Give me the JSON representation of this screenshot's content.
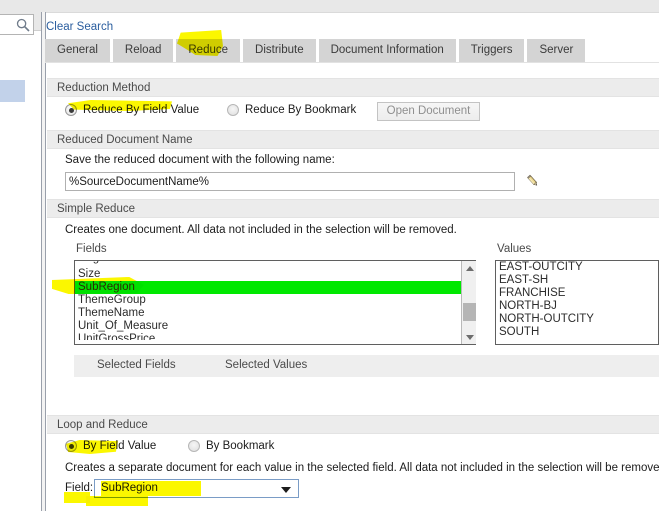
{
  "toolbar": {
    "search_placeholder": "",
    "search_value": "",
    "clear_search_label": "Clear Search",
    "search_icon": "search-icon"
  },
  "tabs": [
    {
      "label": "General",
      "active": false,
      "highlighted": false
    },
    {
      "label": "Reload",
      "active": false,
      "highlighted": false
    },
    {
      "label": "Reduce",
      "active": true,
      "highlighted": true
    },
    {
      "label": "Distribute",
      "active": false,
      "highlighted": false
    },
    {
      "label": "Document Information",
      "active": false,
      "highlighted": false
    },
    {
      "label": "Triggers",
      "active": false,
      "highlighted": false
    },
    {
      "label": "Server",
      "active": false,
      "highlighted": false
    }
  ],
  "reduction_method": {
    "header": "Reduction Method",
    "radio_field_value": "Reduce By Field Value",
    "radio_bookmark": "Reduce By Bookmark",
    "open_document_button": "Open Document"
  },
  "reduced_document_name": {
    "header": "Reduced Document Name",
    "instruction": "Save the reduced document with the following name:",
    "name_value": "%SourceDocumentName%",
    "edit_icon": "pencil-icon"
  },
  "simple_reduce": {
    "header": "Simple Reduce",
    "description": "Creates one document. All data not included in the selection will be removed.",
    "fields_label": "Fields",
    "values_label": "Values",
    "fields": [
      "Region",
      "Size",
      "SubRegion",
      "ThemeGroup",
      "ThemeName",
      "Unit_Of_Measure",
      "UnitGrossPrice"
    ],
    "selected_field": "SubRegion",
    "values": [
      "EAST-OUTCITY",
      "EAST-SH",
      "FRANCHISE",
      "NORTH-BJ",
      "NORTH-OUTCITY",
      "SOUTH"
    ],
    "selected_fields_label": "Selected Fields",
    "selected_values_label": "Selected Values",
    "selected_fields_items": [],
    "selected_values_items": []
  },
  "loop_and_reduce": {
    "header": "Loop and Reduce",
    "radio_field_value": "By Field Value",
    "radio_bookmark": "By Bookmark",
    "description": "Creates a separate document for each value in the selected field. All data not included in the selection will be removed.",
    "field_label": "Field:",
    "field_value": "SubRegion"
  },
  "colors": {
    "highlight_marker": "#fbf700",
    "list_selection_green": "#00e800",
    "link_blue": "#2a5d9e",
    "section_header_bg": "#ececec"
  }
}
